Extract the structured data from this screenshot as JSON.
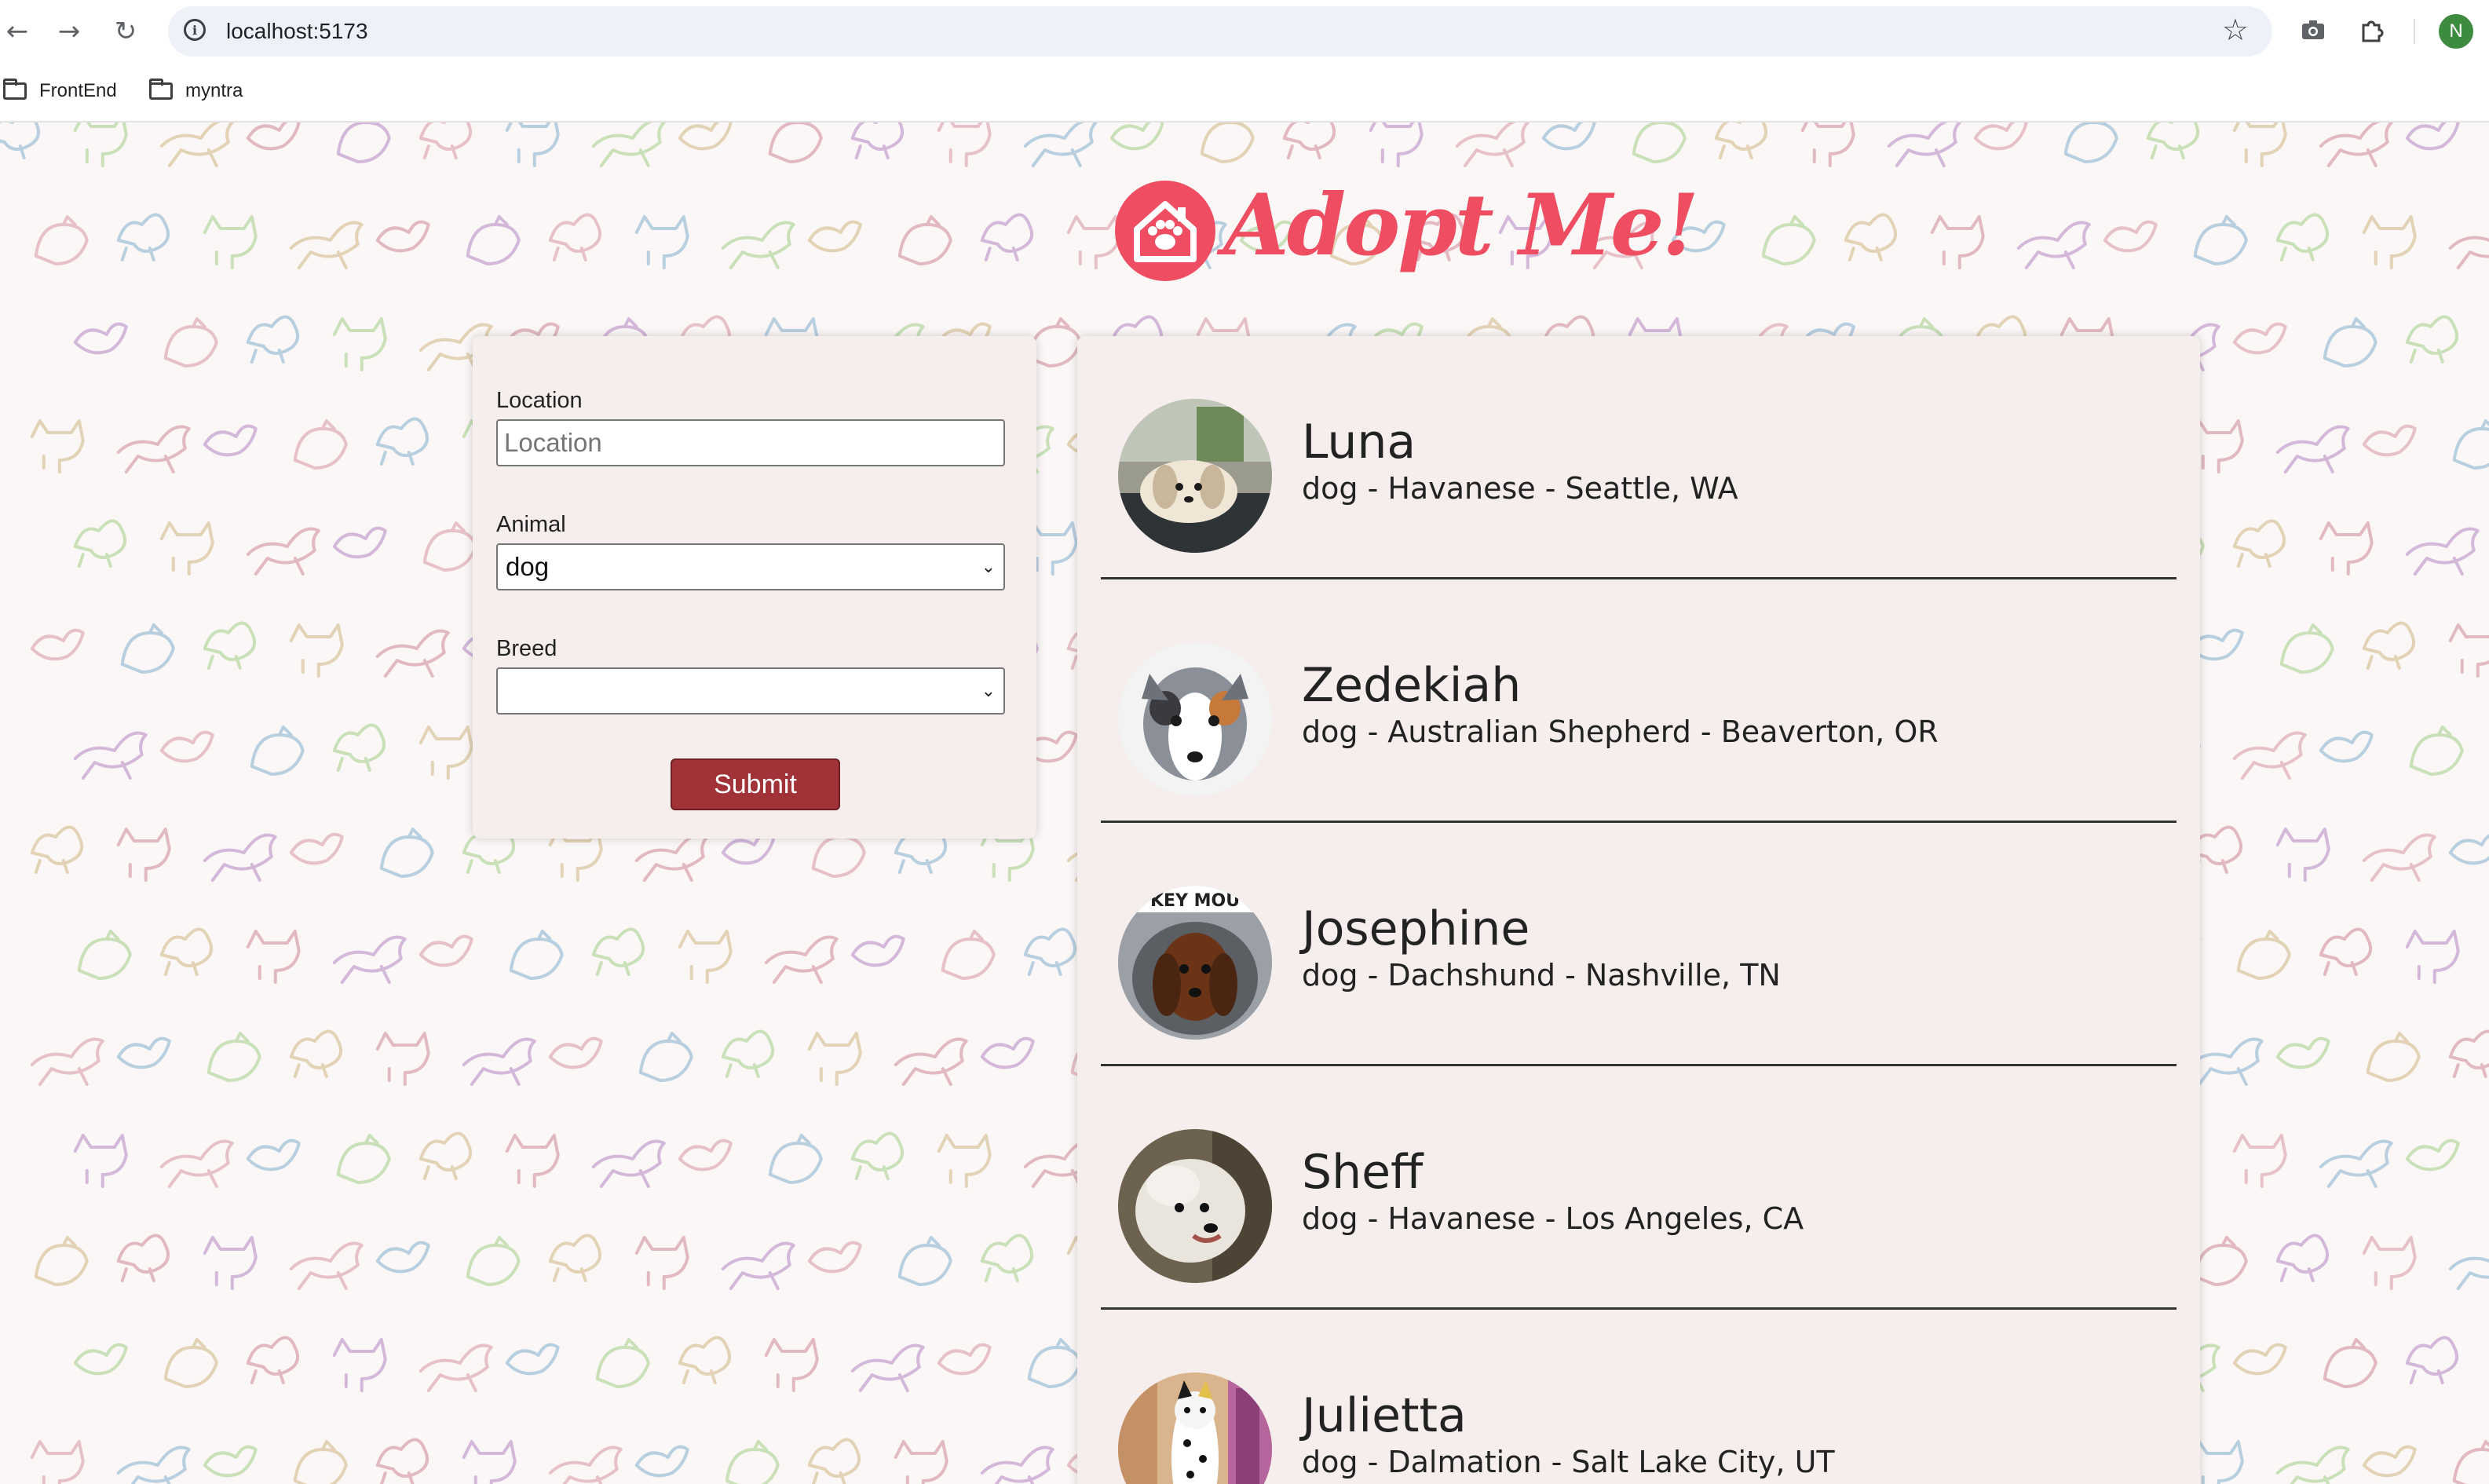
{
  "browser": {
    "url": "localhost:5173",
    "avatar_initial": "N",
    "bookmarks": [
      "FrontEnd",
      "myntra"
    ]
  },
  "page": {
    "logo_text": "Adopt Me!",
    "brand_color": "#ef4d62"
  },
  "search": {
    "location_label": "Location",
    "location_placeholder": "Location",
    "location_value": "",
    "animal_label": "Animal",
    "animal_value": "dog",
    "breed_label": "Breed",
    "breed_value": "",
    "submit_label": "Submit",
    "submit_color": "#a03238"
  },
  "pets": [
    {
      "name": "Luna",
      "description": "dog - Havanese - Seattle, WA"
    },
    {
      "name": "Zedekiah",
      "description": "dog - Australian Shepherd - Beaverton, OR"
    },
    {
      "name": "Josephine",
      "description": "dog - Dachshund - Nashville, TN"
    },
    {
      "name": "Sheff",
      "description": "dog - Havanese - Los Angeles, CA"
    },
    {
      "name": "Julietta",
      "description": "dog - Dalmation - Salt Lake City, UT"
    }
  ]
}
